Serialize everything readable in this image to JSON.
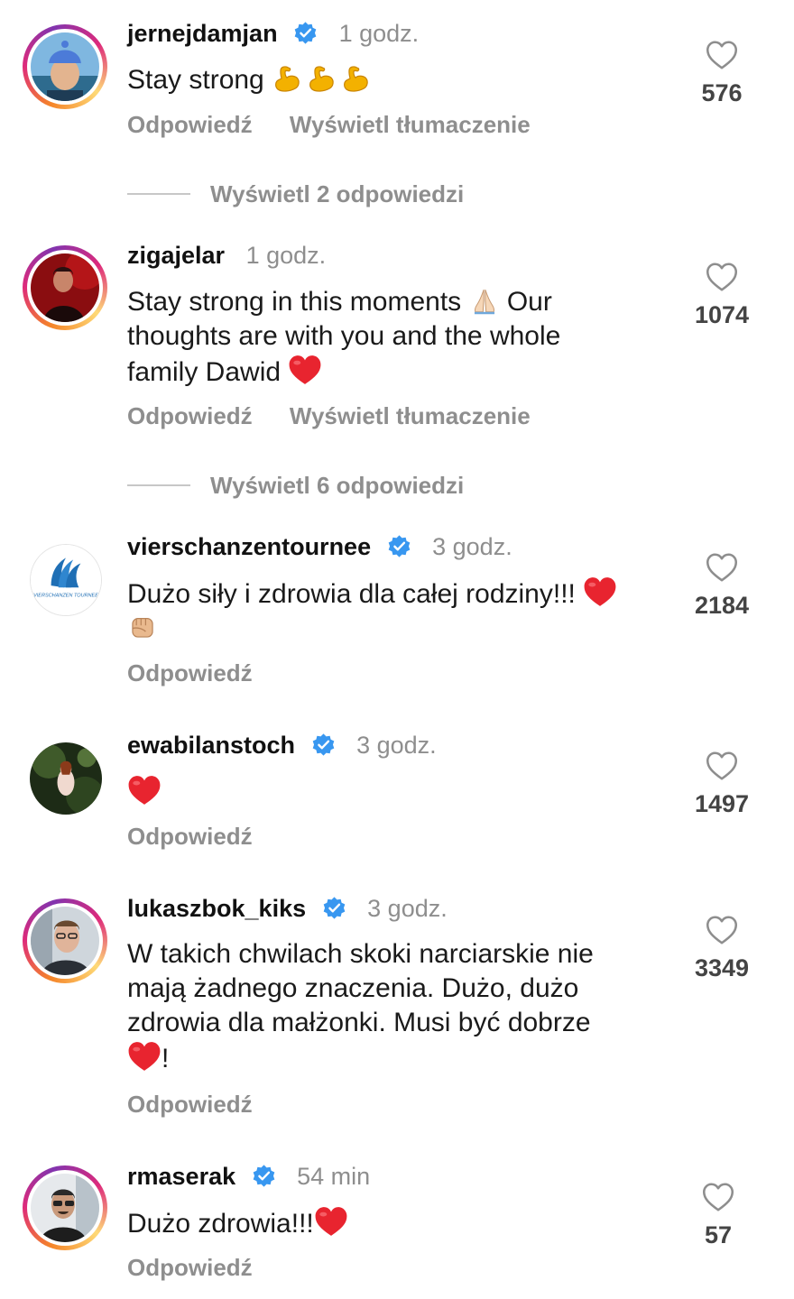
{
  "comments": [
    {
      "username": "jernejdamjan",
      "verified": true,
      "time": "1 godz.",
      "text_prefix": "Stay strong ",
      "emojis": [
        "flexed-biceps",
        "flexed-biceps",
        "flexed-biceps"
      ],
      "likes": "576",
      "reply_label": "Odpowiedź",
      "translate_label": "Wyświetl tłumaczenie",
      "view_replies": "Wyświetl 2 odpowiedzi"
    },
    {
      "username": "zigajelar",
      "verified": false,
      "time": "1 godz.",
      "text_line1": "Stay strong in this moments ",
      "text_line1_after": " Our",
      "text_line2": "thoughts are with you and the whole",
      "text_line3": "family Dawid ",
      "likes": "1074",
      "reply_label": "Odpowiedź",
      "translate_label": "Wyświetl tłumaczenie",
      "view_replies": "Wyświetl 6 odpowiedzi"
    },
    {
      "username": "vierschanzentournee",
      "verified": true,
      "time": "3 godz.",
      "text_line1": "Dużo siły i zdrowia dla całej rodziny!!! ",
      "avatar_logo_text": "VIERSCHANZEN TOURNEE",
      "likes": "2184",
      "reply_label": "Odpowiedź"
    },
    {
      "username": "ewabilanstoch",
      "verified": true,
      "time": "3 godz.",
      "likes": "1497",
      "reply_label": "Odpowiedź"
    },
    {
      "username": "lukaszbok_kiks",
      "verified": true,
      "time": "3 godz.",
      "text_line1": "W takich chwilach skoki narciarskie nie",
      "text_line2": "mają żadnego znaczenia. Dużo, dużo",
      "text_line3": "zdrowia dla małżonki. Musi być dobrze",
      "text_line4_after": "!",
      "likes": "3349",
      "reply_label": "Odpowiedź"
    },
    {
      "username": "rmaserak",
      "verified": true,
      "time": "54 min",
      "text_line1": "Dużo zdrowia!!!",
      "likes": "57",
      "reply_label": "Odpowiedź"
    }
  ],
  "colors": {
    "heart_red": "#e8242f",
    "verified_blue": "#3897f0",
    "muted_text": "#8e8e8e"
  }
}
